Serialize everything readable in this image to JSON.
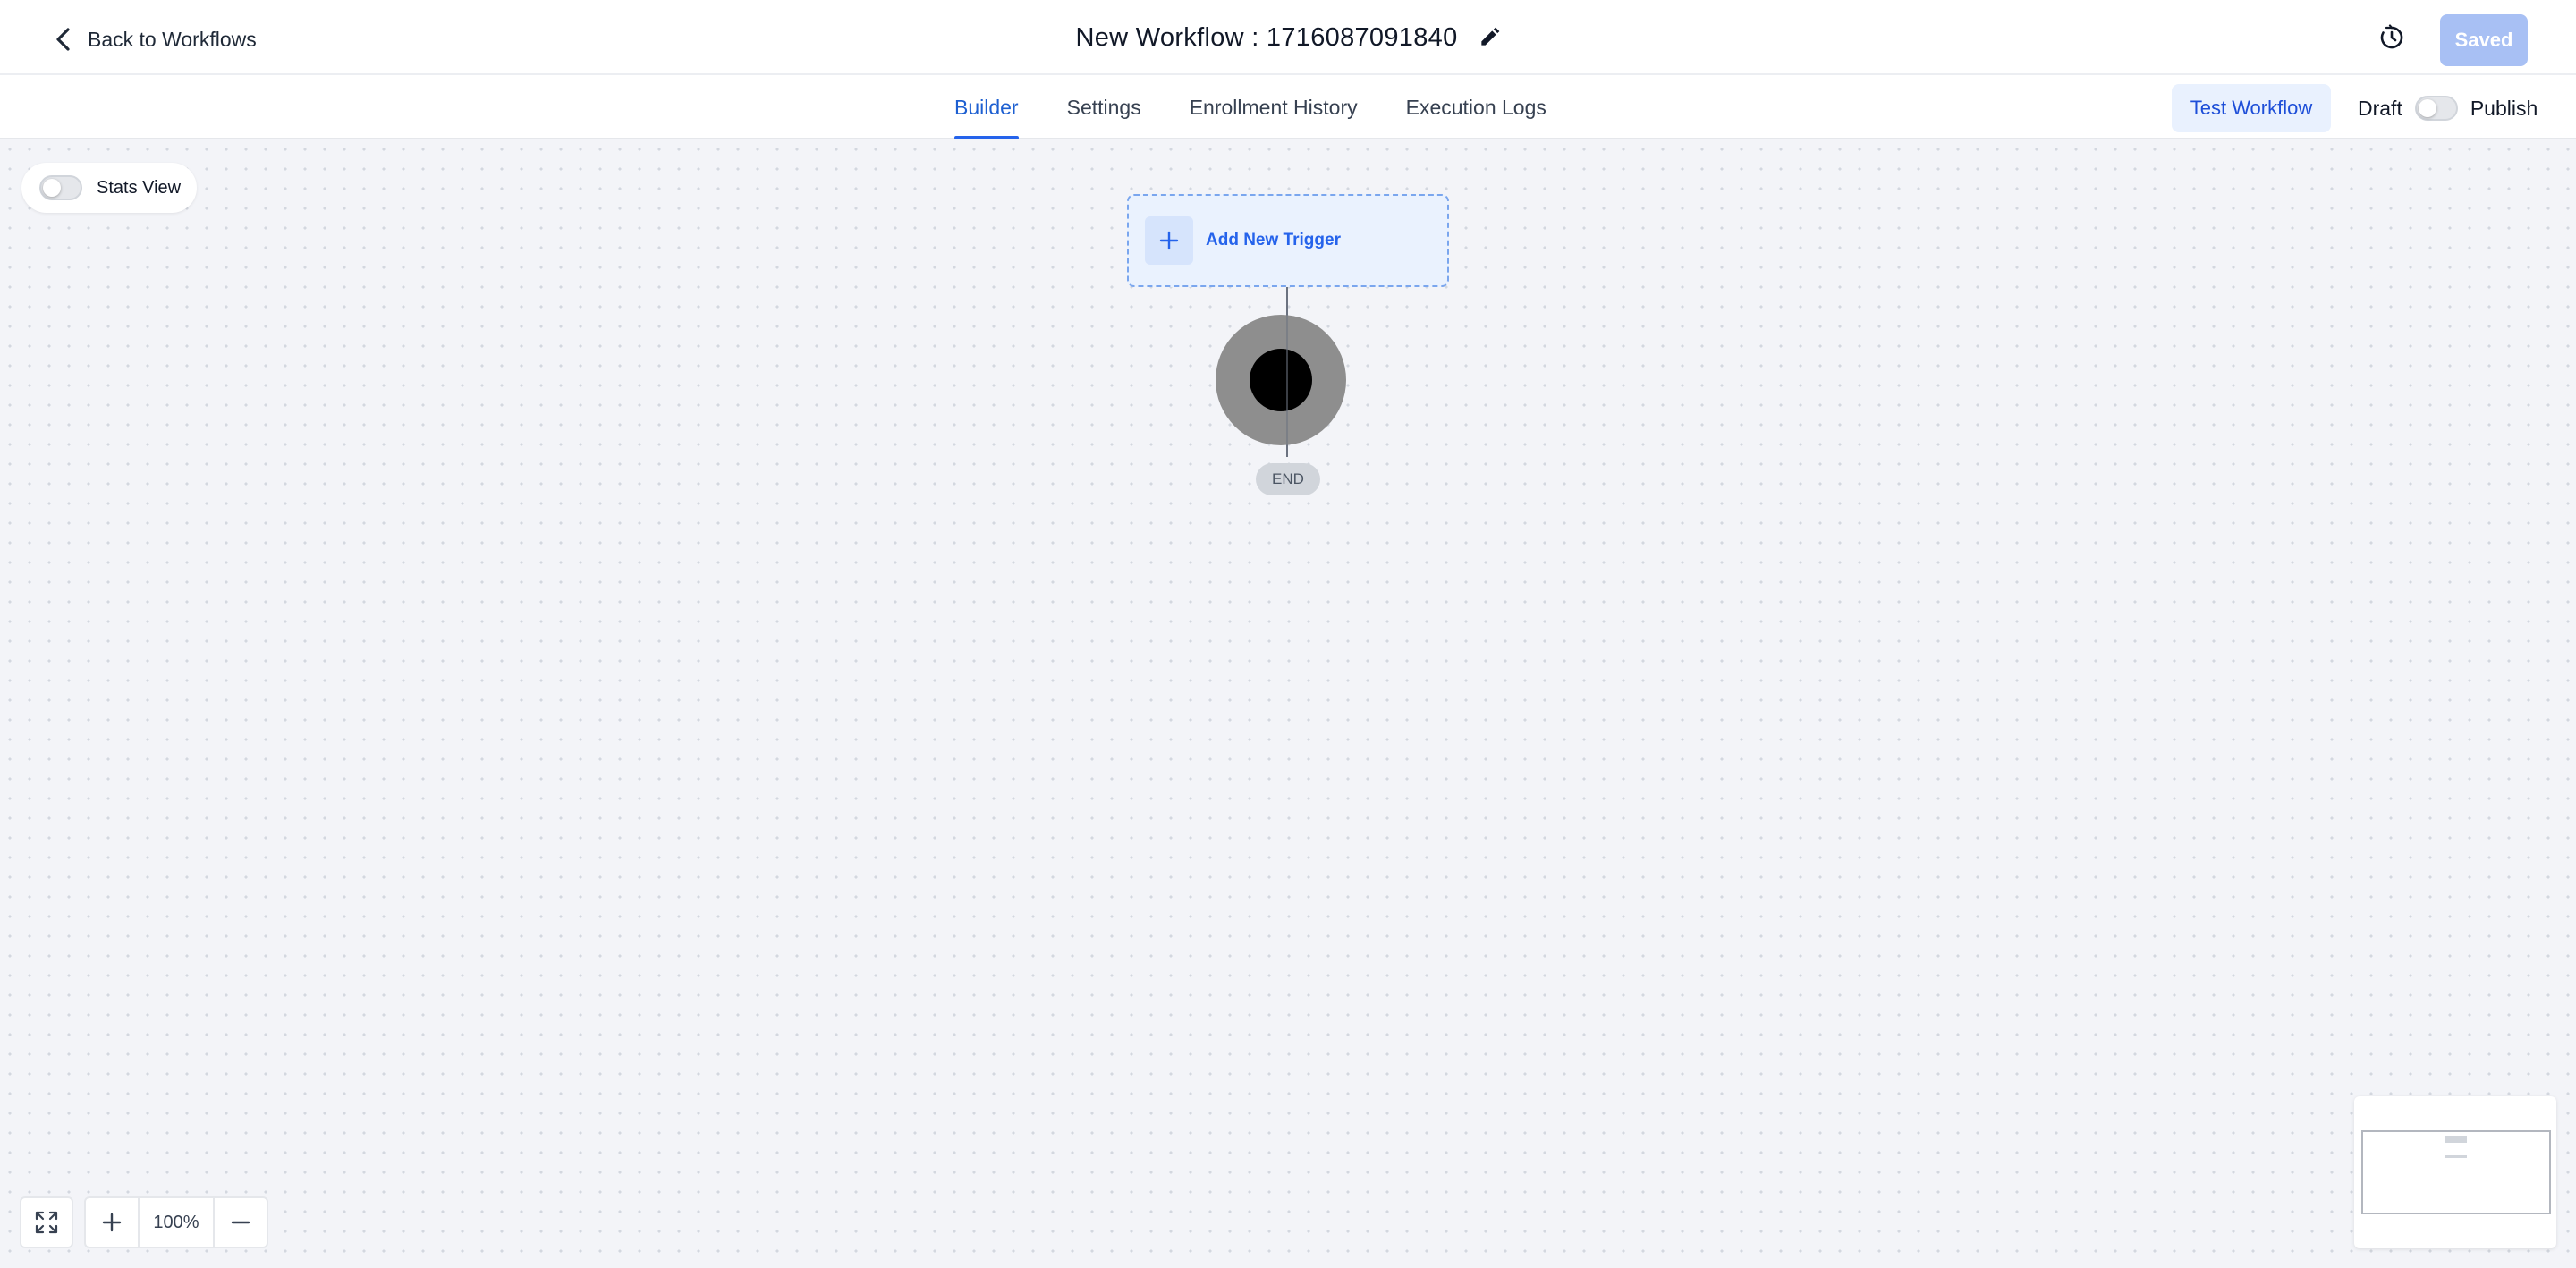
{
  "header": {
    "back_label": "Back to Workflows",
    "workflow_title": "New Workflow : 1716087091840",
    "saved_label": "Saved"
  },
  "tabs": [
    {
      "label": "Builder",
      "active": true
    },
    {
      "label": "Settings",
      "active": false
    },
    {
      "label": "Enrollment History",
      "active": false
    },
    {
      "label": "Execution Logs",
      "active": false
    }
  ],
  "actions": {
    "test_label": "Test Workflow",
    "draft_label": "Draft",
    "publish_label": "Publish",
    "publish_enabled": false
  },
  "canvas": {
    "stats_view_label": "Stats View",
    "stats_view_enabled": false,
    "trigger_label": "Add New Trigger",
    "end_label": "END"
  },
  "controls": {
    "zoom_level": "100%"
  },
  "icons": {
    "back": "chevron-left-icon",
    "edit": "pencil-icon",
    "history": "history-clock-icon",
    "add": "plus-icon",
    "fit": "expand-icon",
    "zoom_in": "plus-icon",
    "zoom_out": "minus-icon"
  },
  "colors": {
    "accent": "#2563eb",
    "saved_button": "#a8c0f4",
    "test_button_bg": "#e9f1fe",
    "canvas_bg": "#f3f4f8",
    "trigger_bg": "#eaf2fe",
    "end_outer": "#8e8e8e",
    "end_inner": "#000000"
  }
}
